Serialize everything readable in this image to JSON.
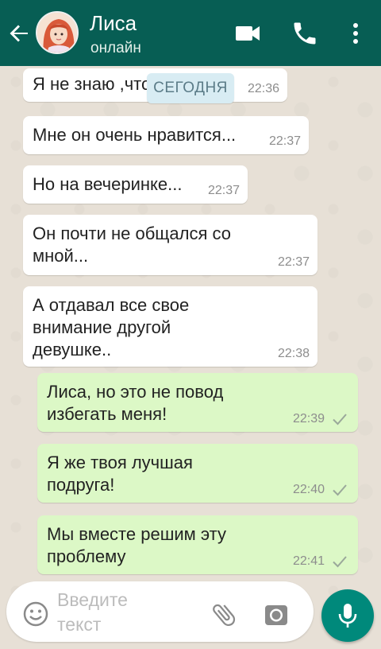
{
  "header": {
    "contact_name": "Лиса",
    "status": "онлайн",
    "icons": [
      "back-arrow-icon",
      "video-call-icon",
      "phone-icon",
      "more-vert-icon"
    ]
  },
  "date_chip": "СЕГОДНЯ",
  "messages": [
    {
      "direction": "in",
      "text": "Я не знаю ,что делать",
      "time": "22:36"
    },
    {
      "direction": "in",
      "text": "Мне он очень нравится...",
      "time": "22:37"
    },
    {
      "direction": "in",
      "text": "Но на вечеринке...",
      "time": "22:37"
    },
    {
      "direction": "in",
      "text": "Он почти не общался со мной...",
      "time": "22:37"
    },
    {
      "direction": "in",
      "text": "А отдавал все свое внимание другой девушке..",
      "time": "22:38"
    },
    {
      "direction": "out",
      "text": "Лиса, но это не повод избегать меня!",
      "time": "22:39",
      "status": "sent"
    },
    {
      "direction": "out",
      "text": "Я же твоя лучшая подруга!",
      "time": "22:40",
      "status": "sent"
    },
    {
      "direction": "out",
      "text": "Мы вместе решим эту проблему",
      "time": "22:41",
      "status": "sent"
    }
  ],
  "composer": {
    "placeholder": "Введите текст",
    "icons": [
      "emoji-icon",
      "paperclip-icon",
      "camera-icon",
      "microphone-icon"
    ]
  },
  "colors": {
    "header": "#075e54",
    "outgoing_bubble": "#dcf8c6",
    "incoming_bubble": "#ffffff",
    "mic_button": "#00897b",
    "date_chip": "#d8ecf3"
  }
}
